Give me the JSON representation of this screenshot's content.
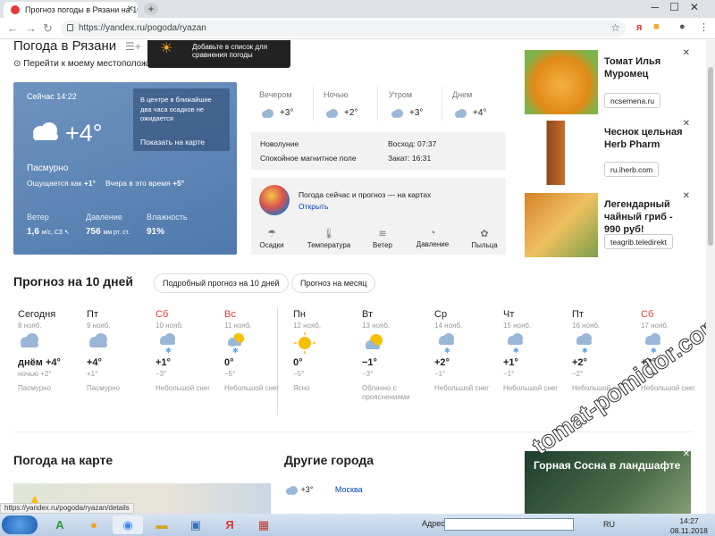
{
  "browser": {
    "tab_title": "Прогноз погоды в Рязани на 10",
    "url": "https://yandex.ru/pogoda/ryazan",
    "status_url": "https://yandex.ru/pogoda/ryazan/details"
  },
  "header": {
    "title": "Погода в Рязани",
    "geo_link": "Перейти к моему местоположению",
    "compare_popup": "Добавьте в список для сравнения погоды"
  },
  "current": {
    "time": "Сейчас 14:22",
    "temp": "+4°",
    "condition": "Пасмурно",
    "feels_label": "Ощущается как",
    "feels_value": "+1°",
    "yesterday_label": "Вчера в это время",
    "yesterday_value": "+5°",
    "precip_note": "В центре в ближайшие два часа осадков не ожидается",
    "show_map": "Показать на карте",
    "wind_label": "Ветер",
    "wind_value": "1,6",
    "wind_unit": "м/с, СЗ",
    "pressure_label": "Давление",
    "pressure_value": "756",
    "pressure_unit": "мм рт. ст.",
    "humidity_label": "Влажность",
    "humidity_value": "91%"
  },
  "day_parts": [
    {
      "label": "Вечером",
      "temp": "+3°"
    },
    {
      "label": "Ночью",
      "temp": "+2°"
    },
    {
      "label": "Утром",
      "temp": "+3°"
    },
    {
      "label": "Днем",
      "temp": "+4°"
    }
  ],
  "info": {
    "moon": "Новолуние",
    "magnetic": "Спокойное магнитное поле",
    "sunrise": "Восход: 07:37",
    "sunset": "Закат: 16:31"
  },
  "maps": {
    "title": "Погода сейчас и прогноз — на картах",
    "open": "Открыть",
    "categories": [
      "Осадки",
      "Температура",
      "Ветер",
      "Давление",
      "Пыльца"
    ]
  },
  "ads": [
    {
      "title": "Томат Илья Муромец",
      "link": "ncsemena.ru"
    },
    {
      "title": "Чеснок цельная Herb Pharm",
      "link": "ru.iherb.com"
    },
    {
      "title": "Легендарный чайный гриб - 990 руб!",
      "link": "teagrib.teledirekt"
    }
  ],
  "forecast": {
    "title": "Прогноз на 10 дней",
    "detailed_button": "Подробный прогноз на 10 дней",
    "month_button": "Прогноз на месяц",
    "days": [
      {
        "name": "Сегодня",
        "date": "8 нояб.",
        "max": "днём +4°",
        "min": "ночью +2°",
        "cond": "Пасмурно",
        "icon": "cloud"
      },
      {
        "name": "Пт",
        "date": "9 нояб.",
        "max": "+4°",
        "min": "+1°",
        "cond": "Пасмурно",
        "icon": "cloud"
      },
      {
        "name": "Сб",
        "date": "10 нояб.",
        "max": "+1°",
        "min": "−3°",
        "cond": "Небольшой снег",
        "icon": "snow"
      },
      {
        "name": "Вс",
        "date": "11 нояб.",
        "max": "0°",
        "min": "−5°",
        "cond": "Небольшой снег",
        "icon": "sun-snow"
      },
      {
        "name": "Пн",
        "date": "12 нояб.",
        "max": "0°",
        "min": "−5°",
        "cond": "Ясно",
        "icon": "sun"
      },
      {
        "name": "Вт",
        "date": "13 нояб.",
        "max": "−1°",
        "min": "−3°",
        "cond": "Облачно с прояснениями",
        "icon": "sun-cloud"
      },
      {
        "name": "Ср",
        "date": "14 нояб.",
        "max": "+2°",
        "min": "−1°",
        "cond": "Небольшой снег",
        "icon": "snow"
      },
      {
        "name": "Чт",
        "date": "15 нояб.",
        "max": "+1°",
        "min": "−1°",
        "cond": "Небольшой снег",
        "icon": "snow"
      },
      {
        "name": "Пт",
        "date": "16 нояб.",
        "max": "+2°",
        "min": "−2°",
        "cond": "Небольшой снег",
        "icon": "snow"
      },
      {
        "name": "Сб",
        "date": "17 нояб.",
        "max": "+2°",
        "min": "−1°",
        "cond": "Небольшой снег",
        "icon": "snow"
      }
    ]
  },
  "bottom": {
    "map_title": "Погода на карте",
    "cities_title": "Другие города",
    "city_temp": "+3°",
    "city_name": "Москва",
    "promo": "Горная Сосна в ландшафте",
    "watermark": "tomat-pomidor.com"
  },
  "taskbar": {
    "address_label": "Адрес",
    "lang": "RU",
    "time": "14:27",
    "date": "08.11.2018"
  }
}
